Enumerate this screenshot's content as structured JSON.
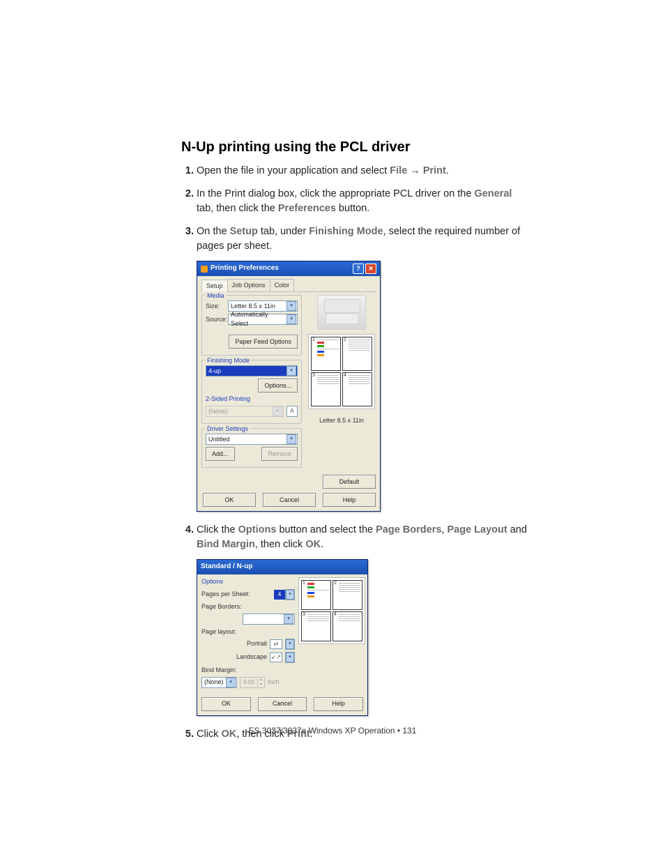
{
  "heading": "N-Up printing using the PCL driver",
  "steps": {
    "s1a": "Open the file in your application and select ",
    "s1_file": "File",
    "s1_arrow": " → ",
    "s1_print": "Print",
    "s1b": ".",
    "s2a": "In the Print dialog box, click the appropriate  PCL driver on the ",
    "s2_general": "General",
    "s2b": " tab, then click the ",
    "s2_pref": "Preferences",
    "s2c": " button.",
    "s3a": "On the ",
    "s3_setup": "Setup",
    "s3b": " tab, under ",
    "s3_fm": "Finishing Mode",
    "s3c": ", select the required number of pages per sheet.",
    "s4a": "Click the ",
    "s4_opt": "Options",
    "s4b": " button and select the ",
    "s4_pb": "Page Borders",
    "s4c": ", ",
    "s4_pl": "Page Layout",
    "s4d": " and ",
    "s4_bm": "Bind Margin",
    "s4e": ", then click ",
    "s4_ok": "OK",
    "s4f": ".",
    "s5a": "Click ",
    "s5_ok": "OK",
    "s5b": ", then click ",
    "s5_print": "Print",
    "s5c": "."
  },
  "dlg1": {
    "title": "Printing Preferences",
    "help_btn": "?",
    "close_btn": "✕",
    "tabs": {
      "setup": "Setup",
      "job": "Job Options",
      "color": "Color"
    },
    "media": {
      "group": "Media",
      "size_lbl": "Size:",
      "size_val": "Letter 8.5 x 11in",
      "source_lbl": "Source:",
      "source_val": "Automatically Select",
      "feed_btn": "Paper Feed Options"
    },
    "finishing": {
      "group": "Finishing Mode",
      "value": "4-up",
      "options_btn": "Options...",
      "twosided_lbl": "2-Sided Printing",
      "twosided_val": "(None)",
      "a_icon": "A"
    },
    "driver": {
      "group": "Driver Settings",
      "value": "Untitled",
      "add_btn": "Add...",
      "remove_btn": "Remove"
    },
    "preview_caption": "Letter 8.5 x 11in",
    "default_btn": "Default",
    "ok_btn": "OK",
    "cancel_btn": "Cancel",
    "help_btn2": "Help",
    "pv_nums": {
      "n1": "1",
      "n2": "2",
      "n3": "3",
      "n4": "4"
    }
  },
  "dlg2": {
    "title": "Standard / N-up",
    "options_group": "Options",
    "pps_lbl": "Pages per Sheet:",
    "pps_val": "4",
    "pb_lbl": "Page Borders:",
    "pb_val": "",
    "pl_lbl": "Page layout:",
    "portrait_lbl": "Portrait",
    "landscape_lbl": "Landscape",
    "bm_lbl": "Bind Margin:",
    "bm_val": "(None)",
    "bm_num": "0.00",
    "bm_unit": "inch",
    "ok_btn": "OK",
    "cancel_btn": "Cancel",
    "help_btn": "Help",
    "pv_nums": {
      "n1": "1",
      "n2": "2",
      "n3": "3",
      "n4": "4"
    }
  },
  "footer": "ES 3037/3037e Windows XP Operation • 131"
}
